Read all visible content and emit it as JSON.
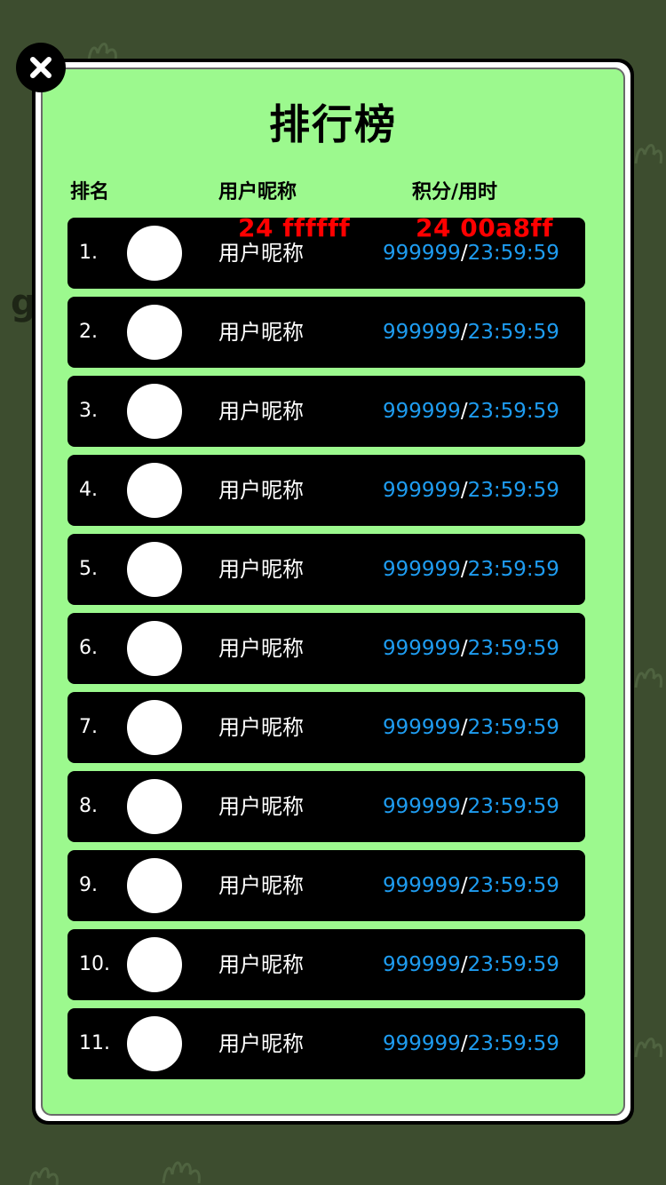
{
  "colors": {
    "backdrop": "#3d4d2f",
    "panel": "#9cf98e",
    "row_bg": "#000000",
    "score_color": "#1e9cf0",
    "annotation": "#ff0000"
  },
  "background": {
    "partial_letter": "g"
  },
  "close_icon": "close-icon",
  "title": "排行榜",
  "headers": {
    "rank": "排名",
    "nickname": "用户昵称",
    "score_time": "积分/用时"
  },
  "annotations": {
    "nick_style": "24 ffffff",
    "score_style": "24 00a8ff"
  },
  "rows": [
    {
      "rank": "1.",
      "nickname": "用户昵称",
      "score": "999999",
      "sep": "/",
      "time": "23:59:59"
    },
    {
      "rank": "2.",
      "nickname": "用户昵称",
      "score": "999999",
      "sep": "/",
      "time": "23:59:59"
    },
    {
      "rank": "3.",
      "nickname": "用户昵称",
      "score": "999999",
      "sep": "/",
      "time": "23:59:59"
    },
    {
      "rank": "4.",
      "nickname": "用户昵称",
      "score": "999999",
      "sep": "/",
      "time": "23:59:59"
    },
    {
      "rank": "5.",
      "nickname": "用户昵称",
      "score": "999999",
      "sep": "/",
      "time": "23:59:59"
    },
    {
      "rank": "6.",
      "nickname": "用户昵称",
      "score": "999999",
      "sep": "/",
      "time": "23:59:59"
    },
    {
      "rank": "7.",
      "nickname": "用户昵称",
      "score": "999999",
      "sep": "/",
      "time": "23:59:59"
    },
    {
      "rank": "8.",
      "nickname": "用户昵称",
      "score": "999999",
      "sep": "/",
      "time": "23:59:59"
    },
    {
      "rank": "9.",
      "nickname": "用户昵称",
      "score": "999999",
      "sep": "/",
      "time": "23:59:59"
    },
    {
      "rank": "10.",
      "nickname": "用户昵称",
      "score": "999999",
      "sep": "/",
      "time": "23:59:59"
    },
    {
      "rank": "11.",
      "nickname": "用户昵称",
      "score": "999999",
      "sep": "/",
      "time": "23:59:59"
    }
  ]
}
